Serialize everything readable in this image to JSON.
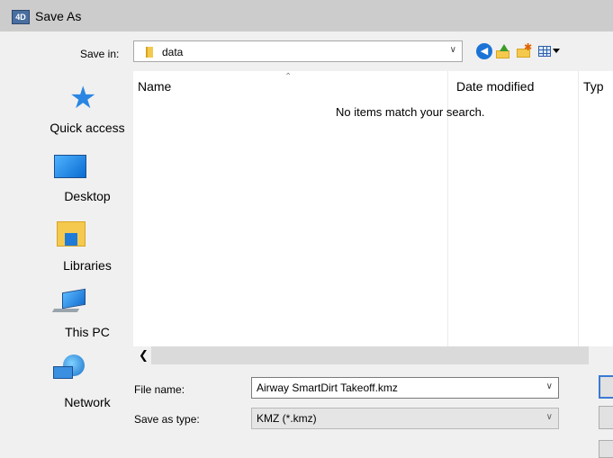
{
  "window": {
    "title": "Save As",
    "app_icon_text": "4D"
  },
  "toolbar": {
    "save_in_label": "Save in:",
    "save_in_value": "data",
    "icons": [
      "back-icon",
      "up-folder-icon",
      "new-folder-icon",
      "view-menu-icon"
    ]
  },
  "places": [
    {
      "label": "Quick access",
      "icon": "quick-access-star-icon"
    },
    {
      "label": "Desktop",
      "icon": "desktop-icon"
    },
    {
      "label": "Libraries",
      "icon": "libraries-icon"
    },
    {
      "label": "This PC",
      "icon": "this-pc-icon"
    },
    {
      "label": "Network",
      "icon": "network-icon"
    }
  ],
  "filelist": {
    "columns": [
      "Name",
      "Date modified",
      "Typ"
    ],
    "empty_message": "No items match your search."
  },
  "form": {
    "filename_label": "File name:",
    "filename_value": "Airway SmartDirt Takeoff.kmz",
    "type_label": "Save as type:",
    "type_value": "KMZ (*.kmz)"
  },
  "colors": {
    "accent": "#3b7ad4",
    "titlebar": "#cccccc",
    "folder": "#f4c94e"
  }
}
